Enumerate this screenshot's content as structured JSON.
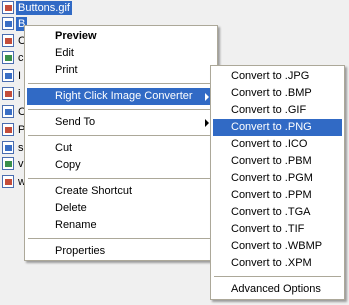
{
  "files": [
    {
      "name": "Buttons.gif"
    },
    {
      "name": "B"
    },
    {
      "name": "C"
    },
    {
      "name": "c"
    },
    {
      "name": "I"
    },
    {
      "name": "i"
    },
    {
      "name": "C"
    },
    {
      "name": "P"
    },
    {
      "name": "s"
    },
    {
      "name": "v"
    },
    {
      "name": "w"
    }
  ],
  "context_menu": {
    "preview": "Preview",
    "edit": "Edit",
    "print": "Print",
    "converter": "Right Click Image Converter",
    "send_to": "Send To",
    "cut": "Cut",
    "copy": "Copy",
    "create_shortcut": "Create Shortcut",
    "delete": "Delete",
    "rename": "Rename",
    "properties": "Properties"
  },
  "convert_menu": {
    "items": [
      "Convert to .JPG",
      "Convert to .BMP",
      "Convert to .GIF",
      "Convert to .PNG",
      "Convert to .ICO",
      "Convert to .PBM",
      "Convert to .PGM",
      "Convert to .PPM",
      "Convert to .TGA",
      "Convert to .TIF",
      "Convert to .WBMP",
      "Convert to .XPM"
    ],
    "advanced": "Advanced Options"
  }
}
